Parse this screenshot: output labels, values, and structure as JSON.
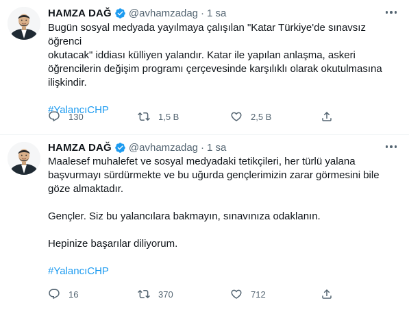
{
  "tweets": [
    {
      "author": "HAMZA DAĞ",
      "handle": "@avhamzadag",
      "dot": "·",
      "time": "1 sa",
      "text_paragraphs": [
        "Bugün sosyal medyada yayılmaya çalışılan \"Katar Türkiye'de sınavsız öğrenci\nokutacak\" iddiası külliyen yalandır. Katar ile yapılan anlaşma, askeri\nöğrencilerin değişim programı çerçevesinde karşılıklı olarak okutulmasına\nilişkindir."
      ],
      "hashtag": "#YalancıCHP",
      "replies": "130",
      "retweets": "1,5 B",
      "likes": "2,5 B"
    },
    {
      "author": "HAMZA DAĞ",
      "handle": "@avhamzadag",
      "dot": "·",
      "time": "1 sa",
      "text_paragraphs": [
        "Maalesef muhalefet ve sosyal medyadaki tetikçileri, her türlü yalana\nbaşvurmayı sürdürmekte ve bu uğurda gençlerimizin zarar görmesini bile\ngöze almaktadır.",
        "Gençler. Siz bu yalancılara bakmayın, sınavınıza odaklanın.",
        "Hepinize başarılar diliyorum."
      ],
      "hashtag": "#YalancıCHP",
      "replies": "16",
      "retweets": "370",
      "likes": "712"
    }
  ],
  "colors": {
    "text": "#0f1419",
    "secondary": "#536471",
    "link": "#1d9bf0",
    "verified": "#1d9bf0",
    "divider": "#eff3f4"
  },
  "icons": [
    "verified-badge-icon",
    "more-icon",
    "reply-icon",
    "retweet-icon",
    "like-icon",
    "share-icon"
  ]
}
